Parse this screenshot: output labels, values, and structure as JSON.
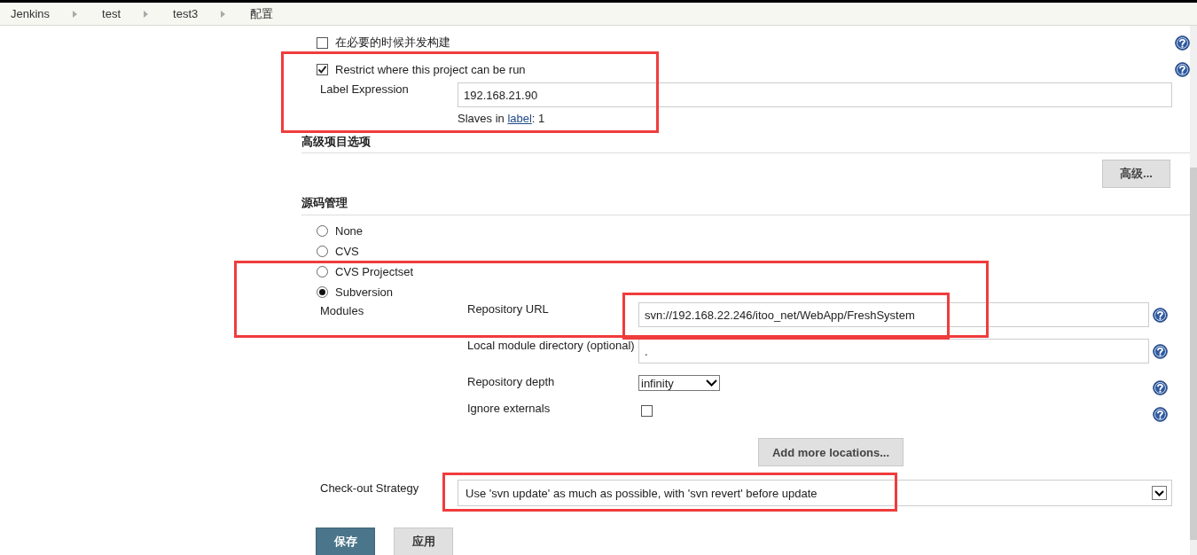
{
  "breadcrumbs": [
    "Jenkins",
    "test",
    "test3",
    "配置"
  ],
  "options": [
    {
      "label": "在必要的时候并发构建",
      "checked": false
    },
    {
      "label": "Restrict where this project can be run",
      "checked": true
    }
  ],
  "label_expression": {
    "label": "Label Expression",
    "value": "192.168.21.90",
    "slaves_before": "Slaves in",
    "slaves_link": "label",
    "slaves_after": ": 1"
  },
  "advanced": {
    "heading": "高级项目选项",
    "button": "高级..."
  },
  "scm": {
    "heading": "源码管理",
    "options": [
      {
        "label": "None",
        "selected": false
      },
      {
        "label": "CVS",
        "selected": false
      },
      {
        "label": "CVS Projectset",
        "selected": false
      },
      {
        "label": "Subversion",
        "selected": true
      }
    ],
    "modules_label": "Modules",
    "fields": [
      {
        "kind": "text",
        "label": "Repository URL",
        "value": "svn://192.168.22.246/itoo_net/WebApp/FreshSystem"
      },
      {
        "kind": "text",
        "label": "Local module directory (optional)",
        "value": "."
      },
      {
        "kind": "select",
        "label": "Repository depth",
        "value": "infinity"
      },
      {
        "kind": "checkbox",
        "label": "Ignore externals",
        "checked": false
      }
    ],
    "add_button": "Add more locations...",
    "strategy": {
      "label": "Check-out Strategy",
      "value": "Use 'svn update' as much as possible, with 'svn revert' before update"
    }
  },
  "buttons": [
    {
      "kind": "primary",
      "label": "保存"
    },
    {
      "kind": "secondary",
      "label": "应用"
    }
  ]
}
